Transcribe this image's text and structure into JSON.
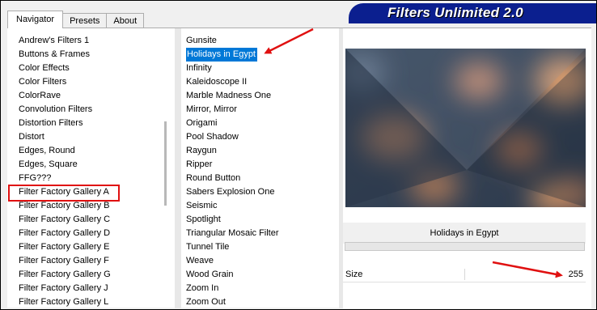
{
  "tabs": [
    {
      "label": "Navigator",
      "active": true
    },
    {
      "label": "Presets",
      "active": false
    },
    {
      "label": "About",
      "active": false
    }
  ],
  "banner_title": "Filters Unlimited 2.0",
  "categories": [
    "Andrew's Filters 1",
    "Buttons & Frames",
    "Color Effects",
    "Color Filters",
    "ColorRave",
    "Convolution Filters",
    "Distortion Filters",
    "Distort",
    "Edges, Round",
    "Edges, Square",
    "FFG???",
    "Filter Factory Gallery A",
    "Filter Factory Gallery B",
    "Filter Factory Gallery C",
    "Filter Factory Gallery D",
    "Filter Factory Gallery E",
    "Filter Factory Gallery F",
    "Filter Factory Gallery G",
    "Filter Factory Gallery J",
    "Filter Factory Gallery L"
  ],
  "highlighted_category": "Filter Factory Gallery A",
  "filters": [
    "Gunsite",
    "Holidays in Egypt",
    "Infinity",
    "Kaleidoscope II",
    "Marble Madness One",
    "Mirror, Mirror",
    "Origami",
    "Pool Shadow",
    "Raygun",
    "Ripper",
    "Round Button",
    "Sabers Explosion One",
    "Seismic",
    "Spotlight",
    "Triangular Mosaic Filter",
    "Tunnel Tile",
    "Weave",
    "Wood Grain",
    "Zoom In",
    "Zoom Out"
  ],
  "selected_filter": "Holidays in Egypt",
  "preview_name": "Holidays in Egypt",
  "slider": {
    "label": "Size",
    "value": "255"
  },
  "colors": {
    "banner": "#0b1f8f",
    "selection": "#0078d7",
    "annotation": "#e01010"
  }
}
